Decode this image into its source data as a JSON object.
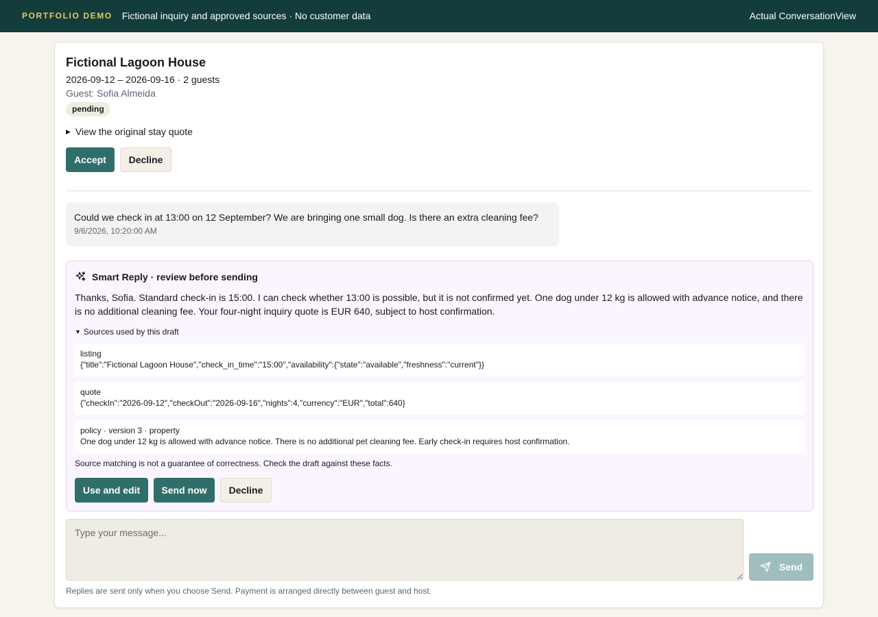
{
  "header": {
    "brand": "PORTFOLIO DEMO",
    "tagline": "Fictional inquiry and approved sources · No customer data",
    "view_name": "Actual ConversationView"
  },
  "booking": {
    "title": "Fictional Lagoon House",
    "dates": "2026-09-12 – 2026-09-16 · 2 guests",
    "guest": "Guest: Sofia Almeida",
    "status": "pending",
    "quote_toggle": "View the original stay quote",
    "accept_label": "Accept",
    "decline_label": "Decline"
  },
  "message": {
    "text": "Could we check in at 13:00 on 12 September? We are bringing one small dog. Is there an extra cleaning fee?",
    "timestamp": "9/6/2026, 10:20:00 AM"
  },
  "smart_reply": {
    "heading": "Smart Reply · review before sending",
    "body": "Thanks, Sofia. Standard check-in is 15:00. I can check whether 13:00 is possible, but it is not confirmed yet. One dog under 12 kg is allowed with advance notice, and there is no additional cleaning fee. Your four-night inquiry quote is EUR 640, subject to host confirmation.",
    "sources_toggle": "Sources used by this draft",
    "sources": [
      {
        "name": "listing",
        "data": "{\"title\":\"Fictional Lagoon House\",\"check_in_time\":\"15:00\",\"availability\":{\"state\":\"available\",\"freshness\":\"current\"}}"
      },
      {
        "name": "quote",
        "data": "{\"checkIn\":\"2026-09-12\",\"checkOut\":\"2026-09-16\",\"nights\":4,\"currency\":\"EUR\",\"total\":640}"
      },
      {
        "name": "policy · version 3 · property",
        "data": "One dog under 12 kg is allowed with advance notice. There is no additional pet cleaning fee. Early check-in requires host confirmation."
      }
    ],
    "disclaimer": "Source matching is not a guarantee of correctness. Check the draft against these facts.",
    "use_edit_label": "Use and edit",
    "send_now_label": "Send now",
    "decline_label": "Decline"
  },
  "composer": {
    "placeholder": "Type your message...",
    "send_label": "Send",
    "footnote": "Replies are sent only when you choose Send. Payment is arranged directly between guest and host."
  },
  "colors": {
    "topbar": "#123d3b",
    "brand": "#f0c65a",
    "primary": "#2f6e6a",
    "smart_bg": "#faf5fe"
  }
}
